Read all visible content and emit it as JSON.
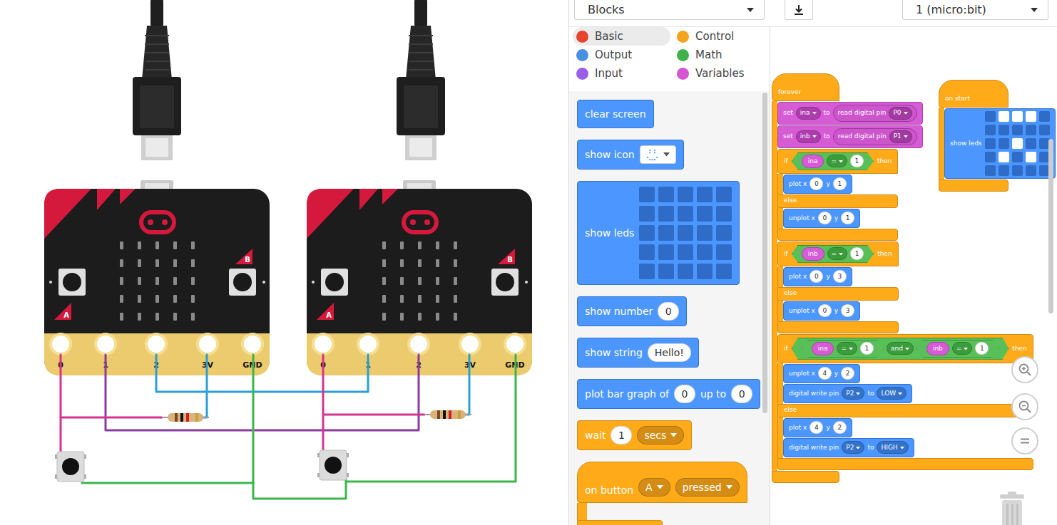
{
  "editor": {
    "mode": "Blocks",
    "device": "1 (micro:bit)"
  },
  "circuit": {
    "boards": [
      {
        "pins": [
          "0",
          "1",
          "2",
          "3V",
          "GND"
        ],
        "button_a": "A",
        "button_b": "B"
      },
      {
        "pins": [
          "0",
          "1",
          "2",
          "3V",
          "GND"
        ],
        "button_a": "A",
        "button_b": "B"
      }
    ]
  },
  "categories": [
    {
      "label": "Basic",
      "color": "#e8432e",
      "selected": true
    },
    {
      "label": "Control",
      "color": "#f5a31a",
      "selected": false
    },
    {
      "label": "Output",
      "color": "#4a90e2",
      "selected": false
    },
    {
      "label": "Math",
      "color": "#3fb34a",
      "selected": false
    },
    {
      "label": "Input",
      "color": "#9a5ee8",
      "selected": false
    },
    {
      "label": "Variables",
      "color": "#d655d3",
      "selected": false
    }
  ],
  "palette": [
    {
      "kind": "stmt",
      "category": "basic",
      "parts": [
        {
          "type": "label",
          "text": "clear screen"
        }
      ]
    },
    {
      "kind": "stmt",
      "category": "basic",
      "parts": [
        {
          "type": "label",
          "text": "show icon"
        },
        {
          "type": "icon"
        }
      ]
    },
    {
      "kind": "stmt",
      "category": "basic",
      "parts": [
        {
          "type": "label",
          "text": "show leds"
        },
        {
          "type": "leds",
          "leds": [
            [
              false,
              false,
              false,
              false,
              false
            ],
            [
              false,
              false,
              false,
              false,
              false
            ],
            [
              false,
              false,
              false,
              false,
              false
            ],
            [
              false,
              false,
              false,
              false,
              false
            ],
            [
              false,
              false,
              false,
              false,
              false
            ]
          ]
        }
      ]
    },
    {
      "kind": "stmt",
      "category": "basic",
      "parts": [
        {
          "type": "label",
          "text": "show number"
        },
        {
          "type": "num",
          "text": "0"
        }
      ]
    },
    {
      "kind": "stmt",
      "category": "basic",
      "parts": [
        {
          "type": "label",
          "text": "show string"
        },
        {
          "type": "num",
          "text": "Hello!"
        }
      ]
    },
    {
      "kind": "stmt",
      "category": "basic",
      "parts": [
        {
          "type": "label",
          "text": "plot bar graph of"
        },
        {
          "type": "num",
          "text": "0"
        },
        {
          "type": "label",
          "text": "up to"
        },
        {
          "type": "num",
          "text": "0"
        }
      ]
    },
    {
      "kind": "stmt",
      "category": "control",
      "parts": [
        {
          "type": "label",
          "text": "wait"
        },
        {
          "type": "num",
          "text": "1"
        },
        {
          "type": "drop",
          "text": "secs"
        }
      ]
    },
    {
      "kind": "hat",
      "category": "control",
      "parts": [
        {
          "type": "label",
          "text": "on button"
        },
        {
          "type": "drop",
          "text": "A"
        },
        {
          "type": "drop",
          "text": "pressed"
        }
      ]
    }
  ],
  "forever": {
    "label": "forever",
    "body": [
      {
        "kind": "stmt",
        "category": "variables",
        "parts": [
          {
            "type": "label",
            "text": "set"
          },
          {
            "type": "drop",
            "text": "ina"
          },
          {
            "type": "label",
            "text": "to"
          },
          {
            "type": "reporter",
            "category": "pins",
            "parts": [
              {
                "type": "label",
                "text": "read digital pin"
              },
              {
                "type": "drop",
                "text": "P0"
              }
            ]
          }
        ]
      },
      {
        "kind": "stmt",
        "category": "variables",
        "parts": [
          {
            "type": "label",
            "text": "set"
          },
          {
            "type": "drop",
            "text": "inb"
          },
          {
            "type": "label",
            "text": "to"
          },
          {
            "type": "reporter",
            "category": "pins",
            "parts": [
              {
                "type": "label",
                "text": "read digital pin"
              },
              {
                "type": "drop",
                "text": "P1"
              }
            ]
          }
        ]
      },
      {
        "kind": "ifelse",
        "if_label": "if",
        "then_label": "then",
        "else_label": "else",
        "cond": [
          {
            "type": "reporter",
            "category": "math",
            "parts": [
              {
                "type": "var",
                "text": "ina"
              },
              {
                "type": "drop",
                "text": "="
              },
              {
                "type": "num",
                "text": "1"
              }
            ]
          }
        ],
        "then": [
          {
            "kind": "stmt",
            "category": "output",
            "parts": [
              {
                "type": "label",
                "text": "plot x"
              },
              {
                "type": "num",
                "text": "0"
              },
              {
                "type": "label",
                "text": "y"
              },
              {
                "type": "num",
                "text": "1"
              }
            ]
          }
        ],
        "else": [
          {
            "kind": "stmt",
            "category": "output",
            "parts": [
              {
                "type": "label",
                "text": "unplot x"
              },
              {
                "type": "num",
                "text": "0"
              },
              {
                "type": "label",
                "text": "y"
              },
              {
                "type": "num",
                "text": "1"
              }
            ]
          }
        ]
      },
      {
        "kind": "ifelse",
        "if_label": "if",
        "then_label": "then",
        "else_label": "else",
        "cond": [
          {
            "type": "reporter",
            "category": "math",
            "parts": [
              {
                "type": "var",
                "text": "inb"
              },
              {
                "type": "drop",
                "text": "="
              },
              {
                "type": "num",
                "text": "1"
              }
            ]
          }
        ],
        "then": [
          {
            "kind": "stmt",
            "category": "output",
            "parts": [
              {
                "type": "label",
                "text": "plot x"
              },
              {
                "type": "num",
                "text": "0"
              },
              {
                "type": "label",
                "text": "y"
              },
              {
                "type": "num",
                "text": "3"
              }
            ]
          }
        ],
        "else": [
          {
            "kind": "stmt",
            "category": "output",
            "parts": [
              {
                "type": "label",
                "text": "unplot x"
              },
              {
                "type": "num",
                "text": "0"
              },
              {
                "type": "label",
                "text": "y"
              },
              {
                "type": "num",
                "text": "3"
              }
            ]
          }
        ]
      },
      {
        "kind": "ifelse",
        "if_label": "if",
        "then_label": "then",
        "else_label": "else",
        "cond": [
          {
            "type": "reporter",
            "category": "math",
            "parts": [
              {
                "type": "reporter",
                "category": "math",
                "parts": [
                  {
                    "type": "var",
                    "text": "ina"
                  },
                  {
                    "type": "drop",
                    "text": "="
                  },
                  {
                    "type": "num",
                    "text": "1"
                  }
                ]
              },
              {
                "type": "drop",
                "text": "and"
              },
              {
                "type": "reporter",
                "category": "math",
                "parts": [
                  {
                    "type": "var",
                    "text": "inb"
                  },
                  {
                    "type": "drop",
                    "text": "="
                  },
                  {
                    "type": "num",
                    "text": "1"
                  }
                ]
              }
            ]
          }
        ],
        "then": [
          {
            "kind": "stmt",
            "category": "output",
            "parts": [
              {
                "type": "label",
                "text": "unplot x"
              },
              {
                "type": "num",
                "text": "4"
              },
              {
                "type": "label",
                "text": "y"
              },
              {
                "type": "num",
                "text": "2"
              }
            ]
          },
          {
            "kind": "stmt",
            "category": "output",
            "parts": [
              {
                "type": "label",
                "text": "digital write pin"
              },
              {
                "type": "drop",
                "text": "P2"
              },
              {
                "type": "label",
                "text": "to"
              },
              {
                "type": "drop",
                "text": "LOW"
              }
            ]
          }
        ],
        "else": [
          {
            "kind": "stmt",
            "category": "output",
            "parts": [
              {
                "type": "label",
                "text": "plot x"
              },
              {
                "type": "num",
                "text": "4"
              },
              {
                "type": "label",
                "text": "y"
              },
              {
                "type": "num",
                "text": "2"
              }
            ]
          },
          {
            "kind": "stmt",
            "category": "output",
            "parts": [
              {
                "type": "label",
                "text": "digital write pin"
              },
              {
                "type": "drop",
                "text": "P2"
              },
              {
                "type": "label",
                "text": "to"
              },
              {
                "type": "drop",
                "text": "HIGH"
              }
            ]
          }
        ]
      }
    ]
  },
  "on_start": {
    "label": "on start",
    "body": [
      {
        "kind": "stmt",
        "category": "basic",
        "parts": [
          {
            "type": "label",
            "text": "show leds"
          },
          {
            "type": "leds",
            "leds": [
              [
                false,
                true,
                true,
                true,
                false
              ],
              [
                false,
                false,
                false,
                false,
                false
              ],
              [
                false,
                false,
                true,
                false,
                false
              ],
              [
                false,
                true,
                false,
                true,
                false
              ],
              [
                false,
                false,
                false,
                false,
                false
              ]
            ]
          }
        ]
      }
    ]
  }
}
